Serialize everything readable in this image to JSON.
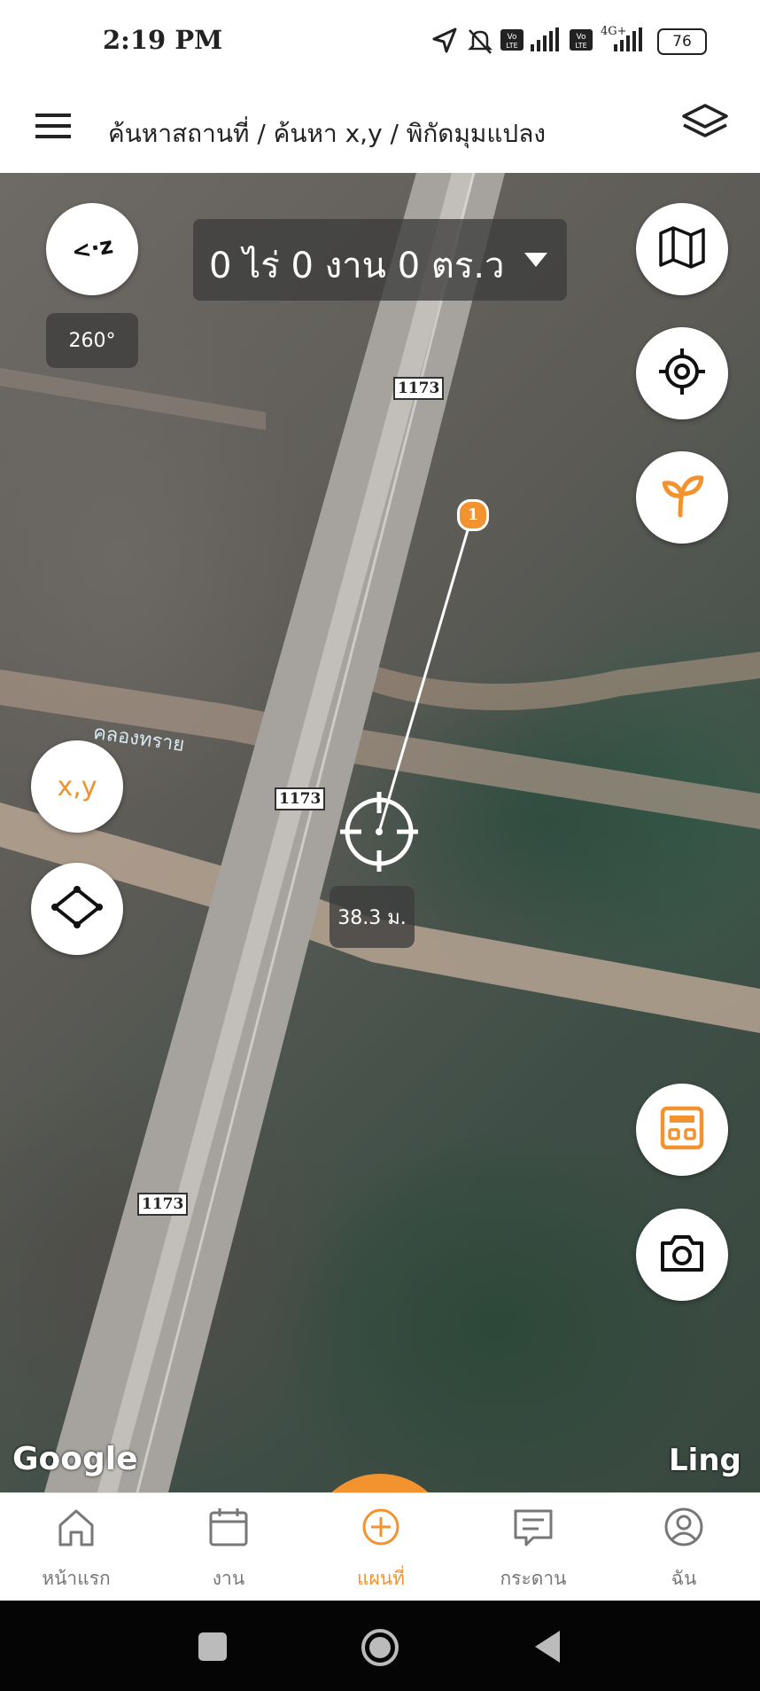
{
  "status_bar": {
    "time": "2:19 PM",
    "network_label": "4G+",
    "battery": "76"
  },
  "header": {
    "menu_icon": "hamburger-menu-icon",
    "breadcrumb": "ค้นหาสถานที่ / ค้นหา x,y / พิกัดมุมแปลง",
    "layers_icon": "layers-icon"
  },
  "map": {
    "area_text": "0 ไร่ 0 งาน 0 ตร.ว",
    "heading": "260°",
    "compass_label": "<·z",
    "distance": "38.3 ม.",
    "point_number": "1",
    "road_labels": [
      "1173",
      "1173",
      "1173"
    ],
    "canal_label": "คลองทราย",
    "xy_button": "x,y",
    "attribution": "Google",
    "watermark": "Ling"
  },
  "colors": {
    "accent": "#f29330",
    "overlay": "#3c3c3c"
  },
  "tabs": [
    {
      "label": "หน้าแรก",
      "icon": "home-icon",
      "active": false
    },
    {
      "label": "งาน",
      "icon": "calendar-icon",
      "active": false
    },
    {
      "label": "แผนที่",
      "icon": "add-circle-icon",
      "active": true
    },
    {
      "label": "กระดาน",
      "icon": "board-icon",
      "active": false
    },
    {
      "label": "ฉัน",
      "icon": "profile-icon",
      "active": false
    }
  ]
}
